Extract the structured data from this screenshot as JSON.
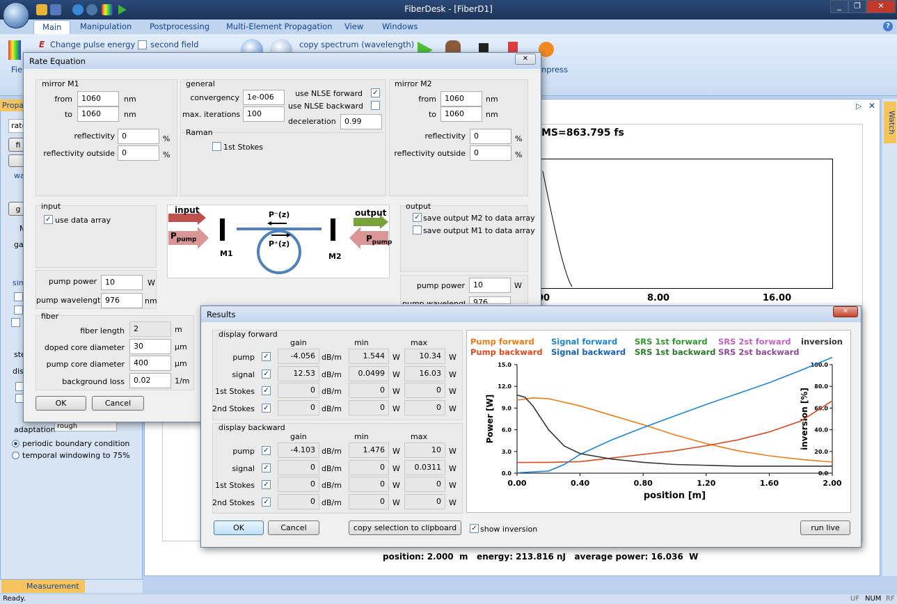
{
  "app": {
    "title": "FiberDesk - [FiberD1]",
    "status": "Ready.",
    "status_indicators": [
      "UF",
      "NUM",
      "RF"
    ],
    "bottom_tab": "Measurement",
    "watch_label": "Watch",
    "left_pane": {
      "header": "Propa",
      "items": [
        "rate",
        "fi",
        "wa",
        "ga",
        "g",
        "M",
        "sim",
        "ste",
        "dist",
        "adaptation"
      ],
      "dropdown_value": "rough",
      "radio1": "periodic boundary condition",
      "radio2": "temporal windowing to 75%"
    },
    "window_buttons": [
      "_",
      "❐",
      "✕"
    ]
  },
  "ribbon": {
    "tabs": [
      "Main",
      "Manipulation",
      "Postprocessing",
      "Multi-Element Propagation",
      "View",
      "Windows"
    ],
    "items": {
      "change_pulse_energy": "Change pulse energy",
      "second_field": "second field",
      "copy_spectrum": "copy spectrum (wavelength)",
      "fie": "Fie",
      "npress": "npress",
      "help": "?"
    }
  },
  "doc": {
    "rms_label": "MS=863.795 fs",
    "x_ticks": [
      "00",
      "8.00",
      "16.00"
    ],
    "footer": "position: 2.000  m   energy: 213.816 nJ   average power: 16.036  W"
  },
  "rate_eq": {
    "title": "Rate Equation",
    "mirror_m1": {
      "title": "mirror M1",
      "from_label": "from",
      "from": "1060",
      "to_label": "to",
      "to": "1060",
      "nm": "nm",
      "refl_label": "reflectivity",
      "refl": "0",
      "refl_out_label": "reflectivity outside",
      "refl_out": "0",
      "pct": "%"
    },
    "general": {
      "title": "general",
      "conv_label": "convergency",
      "conv": "1e-006",
      "iter_label": "max. iterations",
      "iter": "100",
      "nlse_fwd": "use NLSE forward",
      "nlse_bwd": "use NLSE backward",
      "decel_label": "deceleration",
      "decel": "0.99",
      "raman": "Raman",
      "stokes1": "1st Stokes"
    },
    "mirror_m2": {
      "title": "mirror M2",
      "from_label": "from",
      "from": "1060",
      "to_label": "to",
      "to": "1060",
      "nm": "nm",
      "refl_label": "reflectivity",
      "refl": "0",
      "refl_out_label": "reflectivity outside",
      "refl_out": "0",
      "pct": "%"
    },
    "input": {
      "title": "input",
      "use_data": "use data array",
      "pump_power_label": "pump power",
      "pump_power": "10",
      "w": "W",
      "pump_wl_label": "pump wavelength",
      "pump_wl": "976",
      "nm": "nm"
    },
    "output": {
      "title": "output",
      "save_m2": "save output M2 to data array",
      "save_m1": "save output M1 to data array",
      "pump_power_label": "pump power",
      "pump_power": "10",
      "w": "W",
      "pump_wl_label": "pump wavelength",
      "pump_wl": "976",
      "nm": "nm"
    },
    "diagram": {
      "input": "input",
      "output": "output",
      "p_pump": "P",
      "pump_sub": "pump",
      "p_minus": "P⁻(z)",
      "p_plus": "P⁺(z)",
      "m1": "M1",
      "m2": "M2"
    },
    "fiber": {
      "title": "fiber",
      "len_label": "fiber length",
      "len": "2",
      "m": "m",
      "doped_label": "doped core diameter",
      "doped": "30",
      "um": "µm",
      "pcore_label": "pump core diameter",
      "pcore": "400",
      "bg_label": "background loss",
      "bg": "0.02",
      "per_m": "1/m"
    },
    "ok": "OK",
    "cancel": "Cancel"
  },
  "results": {
    "title": "Results",
    "fwd_title": "display forward",
    "bwd_title": "display backward",
    "col_gain": "gain",
    "col_min": "min",
    "col_max": "max",
    "u_db": "dB/m",
    "u_w": "W",
    "fwd_rows": [
      {
        "name": "pump",
        "gain": "-4.056",
        "min": "1.544",
        "max": "10.34"
      },
      {
        "name": "signal",
        "gain": "12.53",
        "min": "0.0499",
        "max": "16.03"
      },
      {
        "name": "1st Stokes",
        "gain": "0",
        "min": "0",
        "max": "0"
      },
      {
        "name": "2nd Stokes",
        "gain": "0",
        "min": "0",
        "max": "0"
      }
    ],
    "bwd_rows": [
      {
        "name": "pump",
        "gain": "-4.103",
        "min": "1.476",
        "max": "10"
      },
      {
        "name": "signal",
        "gain": "0",
        "min": "0",
        "max": "0.0311"
      },
      {
        "name": "1st Stokes",
        "gain": "0",
        "min": "0",
        "max": "0"
      },
      {
        "name": "2nd Stokes",
        "gain": "0",
        "min": "0",
        "max": "0"
      }
    ],
    "ok": "OK",
    "cancel": "Cancel",
    "copy": "copy selection to clipboard",
    "show_inv": "show inversion",
    "run_live": "run live"
  },
  "chart_data": {
    "type": "line",
    "xlabel": "position [m]",
    "ylabel": "Power [W]",
    "y2label": "inversion [%]",
    "xlim": [
      0,
      2
    ],
    "ylim": [
      0,
      15
    ],
    "y2lim": [
      0,
      100
    ],
    "x_ticks": [
      "0.00",
      "0.40",
      "0.80",
      "1.20",
      "1.60",
      "2.00"
    ],
    "y_ticks": [
      "0.0",
      "3.0",
      "6.0",
      "9.0",
      "12.0",
      "15.0"
    ],
    "y2_ticks": [
      "0.0",
      "20.0",
      "40.0",
      "60.0",
      "80.0",
      "100.0"
    ],
    "legend": [
      {
        "name": "Pump forward",
        "color": "#f07a10"
      },
      {
        "name": "Signal forward",
        "color": "#1a84d6"
      },
      {
        "name": "SRS 1st forward",
        "color": "#2e9a2e"
      },
      {
        "name": "SRS 2st forward",
        "color": "#c65fc6"
      },
      {
        "name": "inversion",
        "color": "#333333"
      },
      {
        "name": "Pump backward",
        "color": "#e0471a"
      },
      {
        "name": "Signal backward",
        "color": "#1560c0"
      },
      {
        "name": "SRS 1st backward",
        "color": "#2a7a2a"
      },
      {
        "name": "SRS 2st backward",
        "color": "#8e4a9a"
      }
    ],
    "series": [
      {
        "name": "Pump forward",
        "axis": "left",
        "color": "#f07a10",
        "x": [
          0,
          0.1,
          0.2,
          0.4,
          0.6,
          0.8,
          1.0,
          1.2,
          1.4,
          1.6,
          1.8,
          2.0
        ],
        "values": [
          10.1,
          10.4,
          10.3,
          9.3,
          8.0,
          6.7,
          5.3,
          4.1,
          3.1,
          2.4,
          1.9,
          1.54
        ]
      },
      {
        "name": "Pump backward",
        "axis": "left",
        "color": "#e0471a",
        "x": [
          0,
          0.2,
          0.4,
          0.6,
          0.8,
          1.0,
          1.2,
          1.4,
          1.6,
          1.8,
          2.0
        ],
        "values": [
          1.48,
          1.5,
          1.6,
          2.1,
          2.6,
          3.1,
          3.8,
          4.6,
          5.7,
          7.2,
          10.0
        ]
      },
      {
        "name": "Signal forward",
        "axis": "left",
        "color": "#1a84d6",
        "x": [
          0,
          0.2,
          0.3,
          0.4,
          0.6,
          0.8,
          1.0,
          1.2,
          1.4,
          1.6,
          1.8,
          2.0
        ],
        "values": [
          0.05,
          0.3,
          1.2,
          2.6,
          4.6,
          6.3,
          7.9,
          9.5,
          11.0,
          12.5,
          14.2,
          16.0
        ]
      },
      {
        "name": "inversion",
        "axis": "right",
        "color": "#333333",
        "x": [
          0,
          0.05,
          0.1,
          0.2,
          0.3,
          0.4,
          0.6,
          0.8,
          1.0,
          1.4,
          2.0
        ],
        "values": [
          72,
          70,
          62,
          40,
          25,
          18,
          13,
          10,
          8,
          6.5,
          6.5
        ]
      }
    ]
  }
}
